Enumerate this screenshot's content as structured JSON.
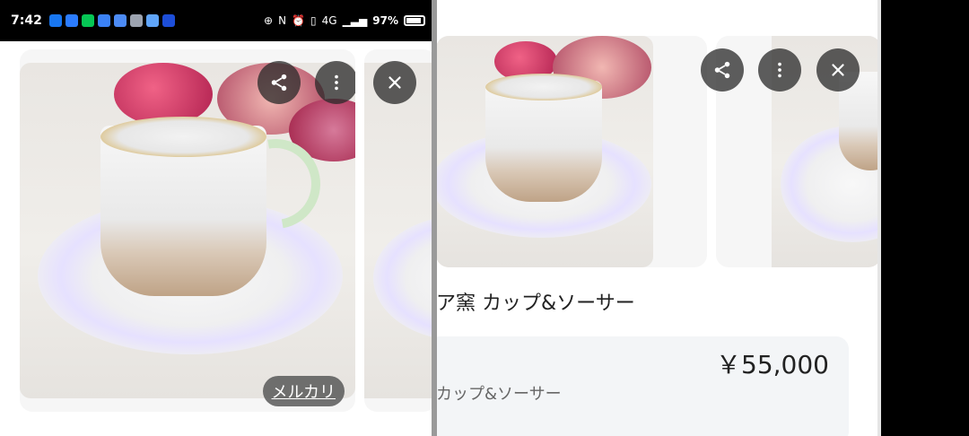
{
  "status_bar": {
    "time": "7:42",
    "signal_label": "4G",
    "battery_percent": "97%",
    "notification_icons": [
      "facebook-icon",
      "messenger-icon",
      "line-icon",
      "chat-icon",
      "gmail-icon",
      "instagram-icon",
      "calendar-icon",
      "photos-icon"
    ]
  },
  "left_card": {
    "source_badge": "メルカリ",
    "buttons": {
      "share_icon": "share-icon",
      "more_icon": "more-vert-icon",
      "close_icon": "close-icon"
    }
  },
  "right_panel": {
    "title": "ア窯 カップ&ソーサー",
    "price": "￥55,000",
    "subtitle": "カップ&ソーサー",
    "buttons": {
      "share_icon": "share-icon",
      "more_icon": "more-vert-icon",
      "close_icon": "close-icon"
    }
  }
}
